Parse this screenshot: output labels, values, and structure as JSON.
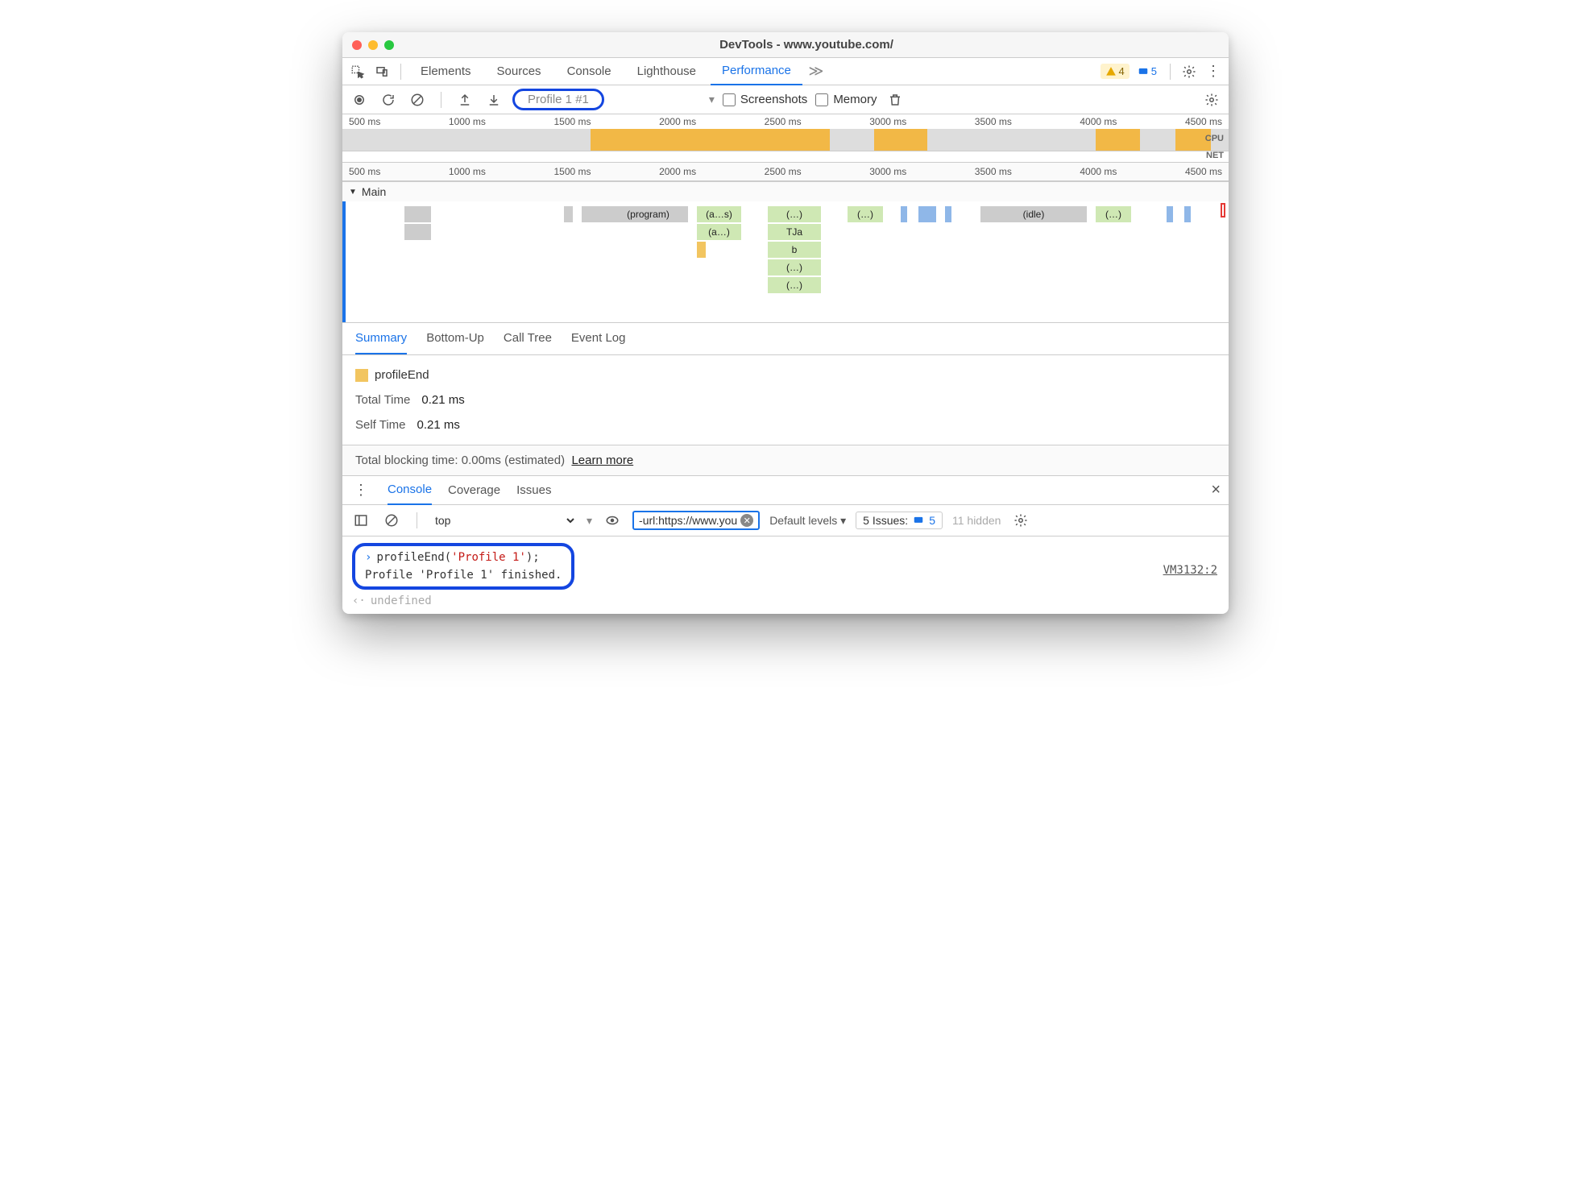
{
  "window": {
    "title": "DevTools - www.youtube.com/"
  },
  "tabs": {
    "elements": "Elements",
    "sources": "Sources",
    "console": "Console",
    "lighthouse": "Lighthouse",
    "performance": "Performance"
  },
  "badges": {
    "warn": "4",
    "msg": "5"
  },
  "toolbar": {
    "profile_label": "Profile 1 #1",
    "screenshots_label": "Screenshots",
    "memory_label": "Memory"
  },
  "ruler": [
    "500 ms",
    "1000 ms",
    "1500 ms",
    "2000 ms",
    "2500 ms",
    "3000 ms",
    "3500 ms",
    "4000 ms",
    "4500 ms"
  ],
  "overview": {
    "cpu": "CPU",
    "net": "NET"
  },
  "flame": {
    "track": "Main",
    "segs": {
      "program": "(program)",
      "as": "(a…s)",
      "a": "(a…)",
      "dots": "(…)",
      "tja": "TJa",
      "b": "b",
      "idle": "(idle)"
    }
  },
  "subtabs": {
    "summary": "Summary",
    "bottomup": "Bottom-Up",
    "calltree": "Call Tree",
    "eventlog": "Event Log"
  },
  "summary": {
    "name": "profileEnd",
    "total_label": "Total Time",
    "total_value": "0.21 ms",
    "self_label": "Self Time",
    "self_value": "0.21 ms"
  },
  "blocking": {
    "text": "Total blocking time: 0.00ms (estimated)",
    "learn": "Learn more"
  },
  "drawer": {
    "console": "Console",
    "coverage": "Coverage",
    "issues": "Issues"
  },
  "consolebar": {
    "context": "top",
    "filter": "-url:https://www.you",
    "levels": "Default levels ▾",
    "issues_label": "5 Issues:",
    "issues_count": "5",
    "hidden": "11 hidden"
  },
  "console": {
    "input_prefix": "profileEnd(",
    "input_arg": "'Profile 1'",
    "input_suffix": ");",
    "output": "Profile 'Profile 1' finished.",
    "source": "VM3132:2",
    "return": "undefined"
  }
}
